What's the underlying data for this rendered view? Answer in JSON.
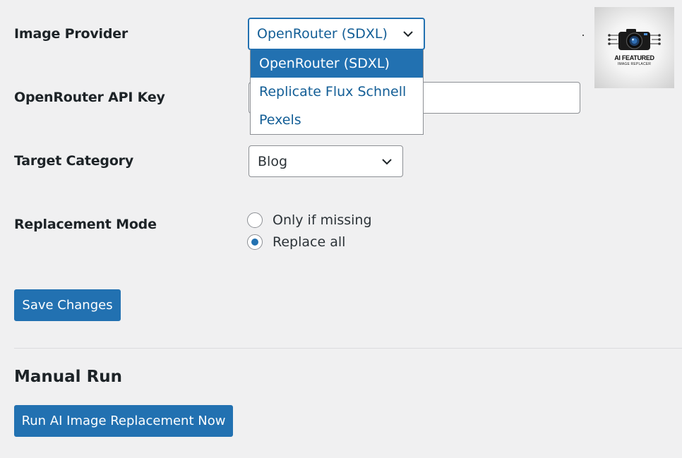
{
  "settings": {
    "image_provider": {
      "label": "Image Provider",
      "selected": "OpenRouter (SDXL)",
      "options": [
        "OpenRouter (SDXL)",
        "Replicate Flux Schnell",
        "Pexels"
      ],
      "highlighted_index": 0
    },
    "api_key": {
      "label": "OpenRouter API Key",
      "value": ""
    },
    "target_category": {
      "label": "Target Category",
      "selected": "Blog"
    },
    "replacement_mode": {
      "label": "Replacement Mode",
      "options": [
        {
          "label": "Only if missing",
          "checked": false
        },
        {
          "label": "Replace all",
          "checked": true
        }
      ]
    },
    "save_label": "Save Changes"
  },
  "manual_run": {
    "title": "Manual Run",
    "button_label": "Run AI Image Replacement Now"
  },
  "logo": {
    "text": "AI FEATURED",
    "subtext": "IMAGE REPLACER"
  },
  "colors": {
    "accent": "#2271b1",
    "background": "#f0f0f1",
    "link": "#135e96"
  }
}
